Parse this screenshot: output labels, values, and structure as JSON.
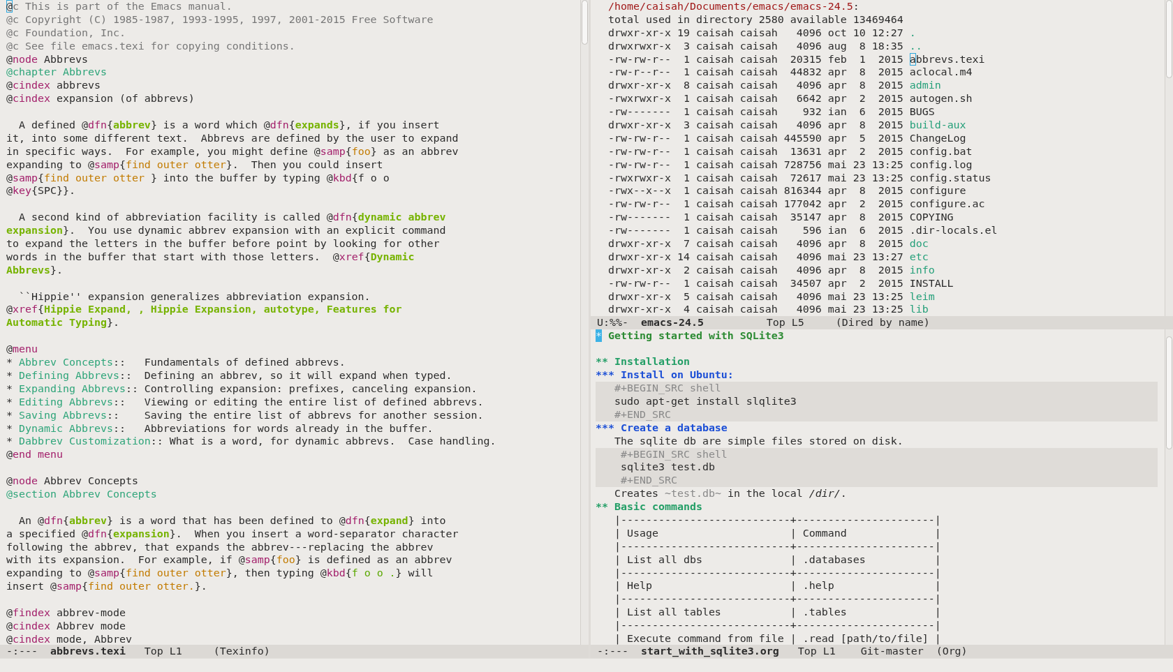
{
  "left_window": {
    "lines": [
      {
        "kind": "text",
        "segments": [
          {
            "kind": "cursor",
            "text": "@"
          },
          {
            "kind": "comment",
            "text": "c This is part of the Emacs manual."
          }
        ]
      },
      {
        "kind": "text",
        "segments": [
          {
            "kind": "comment",
            "text": "@c Copyright (C) 1985-1987, 1993-1995, 1997, 2001-2015 Free Software"
          }
        ]
      },
      {
        "kind": "text",
        "segments": [
          {
            "kind": "comment",
            "text": "@c Foundation, Inc."
          }
        ]
      },
      {
        "kind": "text",
        "segments": [
          {
            "kind": "comment",
            "text": "@c See file emacs.texi for copying conditions."
          }
        ]
      },
      {
        "kind": "text",
        "segments": [
          {
            "kind": "plain",
            "text": "@"
          },
          {
            "kind": "keyword",
            "text": "node"
          },
          {
            "kind": "plain",
            "text": " Abbrevs"
          }
        ]
      },
      {
        "kind": "text",
        "segments": [
          {
            "kind": "heading",
            "text": "@chapter Abbrevs"
          }
        ]
      },
      {
        "kind": "text",
        "segments": [
          {
            "kind": "plain",
            "text": "@"
          },
          {
            "kind": "keyword",
            "text": "cindex"
          },
          {
            "kind": "plain",
            "text": " abbrevs"
          }
        ]
      },
      {
        "kind": "text",
        "segments": [
          {
            "kind": "plain",
            "text": "@"
          },
          {
            "kind": "keyword",
            "text": "cindex"
          },
          {
            "kind": "plain",
            "text": " expansion (of abbrevs)"
          }
        ]
      },
      {
        "kind": "blank"
      },
      {
        "kind": "text",
        "segments": [
          {
            "kind": "plain",
            "text": "  A defined @"
          },
          {
            "kind": "keyword",
            "text": "dfn"
          },
          {
            "kind": "plain",
            "text": "{"
          },
          {
            "kind": "term",
            "text": "abbrev"
          },
          {
            "kind": "plain",
            "text": "} is a word which @"
          },
          {
            "kind": "keyword",
            "text": "dfn"
          },
          {
            "kind": "plain",
            "text": "{"
          },
          {
            "kind": "term",
            "text": "expands"
          },
          {
            "kind": "plain",
            "text": "}, if you insert"
          }
        ]
      },
      {
        "kind": "text",
        "segments": [
          {
            "kind": "plain",
            "text": "it, into some different text.  Abbrevs are defined by the user to expand"
          }
        ]
      },
      {
        "kind": "text",
        "segments": [
          {
            "kind": "plain",
            "text": "in specific ways.  For example, you might define @"
          },
          {
            "kind": "keyword",
            "text": "samp"
          },
          {
            "kind": "plain",
            "text": "{"
          },
          {
            "kind": "sample",
            "text": "foo"
          },
          {
            "kind": "plain",
            "text": "} as an abbrev"
          }
        ]
      },
      {
        "kind": "text",
        "segments": [
          {
            "kind": "plain",
            "text": "expanding to @"
          },
          {
            "kind": "keyword",
            "text": "samp"
          },
          {
            "kind": "plain",
            "text": "{"
          },
          {
            "kind": "sample",
            "text": "find outer otter"
          },
          {
            "kind": "plain",
            "text": "}.  Then you could insert"
          }
        ]
      },
      {
        "kind": "text",
        "segments": [
          {
            "kind": "plain",
            "text": "@"
          },
          {
            "kind": "keyword",
            "text": "samp"
          },
          {
            "kind": "plain",
            "text": "{"
          },
          {
            "kind": "sample",
            "text": "find outer otter "
          },
          {
            "kind": "plain",
            "text": "} into the buffer by typing @"
          },
          {
            "kind": "keyword",
            "text": "kbd"
          },
          {
            "kind": "plain",
            "text": "{f o o"
          }
        ]
      },
      {
        "kind": "text",
        "segments": [
          {
            "kind": "plain",
            "text": "@"
          },
          {
            "kind": "keyword",
            "text": "key"
          },
          {
            "kind": "plain",
            "text": "{SPC}}."
          }
        ]
      },
      {
        "kind": "blank"
      },
      {
        "kind": "text",
        "segments": [
          {
            "kind": "plain",
            "text": "  A second kind of abbreviation facility is called @"
          },
          {
            "kind": "keyword",
            "text": "dfn"
          },
          {
            "kind": "plain",
            "text": "{"
          },
          {
            "kind": "term",
            "text": "dynamic abbrev"
          }
        ]
      },
      {
        "kind": "text",
        "segments": [
          {
            "kind": "term",
            "text": "expansion"
          },
          {
            "kind": "plain",
            "text": "}.  You use dynamic abbrev expansion with an explicit command"
          }
        ]
      },
      {
        "kind": "text",
        "segments": [
          {
            "kind": "plain",
            "text": "to expand the letters in the buffer before point by looking for other"
          }
        ]
      },
      {
        "kind": "text",
        "segments": [
          {
            "kind": "plain",
            "text": "words in the buffer that start with those letters.  @"
          },
          {
            "kind": "keyword",
            "text": "xref"
          },
          {
            "kind": "plain",
            "text": "{"
          },
          {
            "kind": "term",
            "text": "Dynamic"
          }
        ]
      },
      {
        "kind": "text",
        "segments": [
          {
            "kind": "term",
            "text": "Abbrevs"
          },
          {
            "kind": "plain",
            "text": "}."
          }
        ]
      },
      {
        "kind": "blank"
      },
      {
        "kind": "text",
        "segments": [
          {
            "kind": "plain",
            "text": "  ``Hippie'' expansion generalizes abbreviation expansion."
          }
        ]
      },
      {
        "kind": "text",
        "segments": [
          {
            "kind": "plain",
            "text": "@"
          },
          {
            "kind": "keyword",
            "text": "xref"
          },
          {
            "kind": "plain",
            "text": "{"
          },
          {
            "kind": "term",
            "text": "Hippie Expand, , Hippie Expansion, autotype, Features for"
          }
        ]
      },
      {
        "kind": "text",
        "segments": [
          {
            "kind": "term",
            "text": "Automatic Typing"
          },
          {
            "kind": "plain",
            "text": "}."
          }
        ]
      },
      {
        "kind": "blank"
      },
      {
        "kind": "text",
        "segments": [
          {
            "kind": "plain",
            "text": "@"
          },
          {
            "kind": "keyword",
            "text": "menu"
          }
        ]
      },
      {
        "kind": "text",
        "segments": [
          {
            "kind": "plain",
            "text": "* "
          },
          {
            "kind": "heading",
            "text": "Abbrev Concepts"
          },
          {
            "kind": "plain",
            "text": "::   Fundamentals of defined abbrevs."
          }
        ]
      },
      {
        "kind": "text",
        "segments": [
          {
            "kind": "plain",
            "text": "* "
          },
          {
            "kind": "heading",
            "text": "Defining Abbrevs"
          },
          {
            "kind": "plain",
            "text": "::  Defining an abbrev, so it will expand when typed."
          }
        ]
      },
      {
        "kind": "text",
        "segments": [
          {
            "kind": "plain",
            "text": "* "
          },
          {
            "kind": "heading",
            "text": "Expanding Abbrevs"
          },
          {
            "kind": "plain",
            "text": ":: Controlling expansion: prefixes, canceling expansion."
          }
        ]
      },
      {
        "kind": "text",
        "segments": [
          {
            "kind": "plain",
            "text": "* "
          },
          {
            "kind": "heading",
            "text": "Editing Abbrevs"
          },
          {
            "kind": "plain",
            "text": "::   Viewing or editing the entire list of defined abbrevs."
          }
        ]
      },
      {
        "kind": "text",
        "segments": [
          {
            "kind": "plain",
            "text": "* "
          },
          {
            "kind": "heading",
            "text": "Saving Abbrevs"
          },
          {
            "kind": "plain",
            "text": "::    Saving the entire list of abbrevs for another session."
          }
        ]
      },
      {
        "kind": "text",
        "segments": [
          {
            "kind": "plain",
            "text": "* "
          },
          {
            "kind": "heading",
            "text": "Dynamic Abbrevs"
          },
          {
            "kind": "plain",
            "text": "::   Abbreviations for words already in the buffer."
          }
        ]
      },
      {
        "kind": "text",
        "segments": [
          {
            "kind": "plain",
            "text": "* "
          },
          {
            "kind": "heading",
            "text": "Dabbrev Customization"
          },
          {
            "kind": "plain",
            "text": ":: What is a word, for dynamic abbrevs.  Case handling."
          }
        ]
      },
      {
        "kind": "text",
        "segments": [
          {
            "kind": "plain",
            "text": "@"
          },
          {
            "kind": "keyword",
            "text": "end menu"
          }
        ]
      },
      {
        "kind": "blank"
      },
      {
        "kind": "text",
        "segments": [
          {
            "kind": "plain",
            "text": "@"
          },
          {
            "kind": "keyword",
            "text": "node"
          },
          {
            "kind": "plain",
            "text": " Abbrev Concepts"
          }
        ]
      },
      {
        "kind": "text",
        "segments": [
          {
            "kind": "heading",
            "text": "@section Abbrev Concepts"
          }
        ]
      },
      {
        "kind": "blank"
      },
      {
        "kind": "text",
        "segments": [
          {
            "kind": "plain",
            "text": "  An @"
          },
          {
            "kind": "keyword",
            "text": "dfn"
          },
          {
            "kind": "plain",
            "text": "{"
          },
          {
            "kind": "term",
            "text": "abbrev"
          },
          {
            "kind": "plain",
            "text": "} is a word that has been defined to @"
          },
          {
            "kind": "keyword",
            "text": "dfn"
          },
          {
            "kind": "plain",
            "text": "{"
          },
          {
            "kind": "term",
            "text": "expand"
          },
          {
            "kind": "plain",
            "text": "} into"
          }
        ]
      },
      {
        "kind": "text",
        "segments": [
          {
            "kind": "plain",
            "text": "a specified @"
          },
          {
            "kind": "keyword",
            "text": "dfn"
          },
          {
            "kind": "plain",
            "text": "{"
          },
          {
            "kind": "term",
            "text": "expansion"
          },
          {
            "kind": "plain",
            "text": "}.  When you insert a word-separator character"
          }
        ]
      },
      {
        "kind": "text",
        "segments": [
          {
            "kind": "plain",
            "text": "following the abbrev, that expands the abbrev---replacing the abbrev"
          }
        ]
      },
      {
        "kind": "text",
        "segments": [
          {
            "kind": "plain",
            "text": "with its expansion.  For example, if @"
          },
          {
            "kind": "keyword",
            "text": "samp"
          },
          {
            "kind": "plain",
            "text": "{"
          },
          {
            "kind": "sample",
            "text": "foo"
          },
          {
            "kind": "plain",
            "text": "} is defined as an abbrev"
          }
        ]
      },
      {
        "kind": "text",
        "segments": [
          {
            "kind": "plain",
            "text": "expanding to @"
          },
          {
            "kind": "keyword",
            "text": "samp"
          },
          {
            "kind": "plain",
            "text": "{"
          },
          {
            "kind": "sample",
            "text": "find outer otter"
          },
          {
            "kind": "plain",
            "text": "}, then typing @"
          },
          {
            "kind": "keyword",
            "text": "kbd"
          },
          {
            "kind": "plain",
            "text": "{"
          },
          {
            "kind": "key",
            "text": "f o o ."
          },
          {
            "kind": "plain",
            "text": "} will"
          }
        ]
      },
      {
        "kind": "text",
        "segments": [
          {
            "kind": "plain",
            "text": "insert @"
          },
          {
            "kind": "keyword",
            "text": "samp"
          },
          {
            "kind": "plain",
            "text": "{"
          },
          {
            "kind": "sample",
            "text": "find outer otter."
          },
          {
            "kind": "plain",
            "text": "}."
          }
        ]
      },
      {
        "kind": "blank"
      },
      {
        "kind": "text",
        "segments": [
          {
            "kind": "plain",
            "text": "@"
          },
          {
            "kind": "keyword",
            "text": "findex"
          },
          {
            "kind": "plain",
            "text": " abbrev-mode"
          }
        ]
      },
      {
        "kind": "text",
        "segments": [
          {
            "kind": "plain",
            "text": "@"
          },
          {
            "kind": "keyword",
            "text": "cindex"
          },
          {
            "kind": "plain",
            "text": " Abbrev mode"
          }
        ]
      },
      {
        "kind": "text",
        "segments": [
          {
            "kind": "plain",
            "text": "@"
          },
          {
            "kind": "keyword",
            "text": "cindex"
          },
          {
            "kind": "plain",
            "text": " mode, Abbrev"
          }
        ]
      }
    ],
    "mode_line": [
      {
        "kind": "plain",
        "text": "-:---  "
      },
      {
        "kind": "buffer",
        "text": "abbrevs.texi"
      },
      {
        "kind": "plain",
        "text": "   Top L1     (Texinfo)"
      }
    ]
  },
  "dired_window": {
    "lines": [
      {
        "kind": "text",
        "segments": [
          {
            "kind": "path",
            "text": "  /home/caisah/Documents/emacs/emacs-24.5"
          },
          {
            "kind": "plain",
            "text": ":"
          }
        ]
      },
      {
        "kind": "text",
        "segments": [
          {
            "kind": "plain",
            "text": "  total used in directory 2580 available 13469464"
          }
        ]
      },
      {
        "kind": "text",
        "segments": [
          {
            "kind": "plain",
            "text": "  drwxr-xr-x 19 caisah caisah   4096 oct 10 12:27 "
          },
          {
            "kind": "dir",
            "text": "."
          }
        ]
      },
      {
        "kind": "text",
        "segments": [
          {
            "kind": "plain",
            "text": "  drwxrwxr-x  3 caisah caisah   4096 aug  8 18:35 "
          },
          {
            "kind": "dir",
            "text": ".."
          }
        ]
      },
      {
        "kind": "text",
        "segments": [
          {
            "kind": "plain",
            "text": "  -rw-rw-r--  1 caisah caisah  20315 feb  1  2015 "
          },
          {
            "kind": "cursor",
            "text": "a"
          },
          {
            "kind": "plain",
            "text": "bbrevs.texi"
          }
        ]
      },
      {
        "kind": "text",
        "segments": [
          {
            "kind": "plain",
            "text": "  -rw-r--r--  1 caisah caisah  44832 apr  8  2015 aclocal.m4"
          }
        ]
      },
      {
        "kind": "text",
        "segments": [
          {
            "kind": "plain",
            "text": "  drwxr-xr-x  8 caisah caisah   4096 apr  8  2015 "
          },
          {
            "kind": "dir",
            "text": "admin"
          }
        ]
      },
      {
        "kind": "text",
        "segments": [
          {
            "kind": "plain",
            "text": "  -rwxrwxr-x  1 caisah caisah   6642 apr  2  2015 autogen.sh"
          }
        ]
      },
      {
        "kind": "text",
        "segments": [
          {
            "kind": "plain",
            "text": "  -rw-------  1 caisah caisah    932 ian  6  2015 BUGS"
          }
        ]
      },
      {
        "kind": "text",
        "segments": [
          {
            "kind": "plain",
            "text": "  drwxr-xr-x  3 caisah caisah   4096 apr  8  2015 "
          },
          {
            "kind": "dir",
            "text": "build-aux"
          }
        ]
      },
      {
        "kind": "text",
        "segments": [
          {
            "kind": "plain",
            "text": "  -rw-rw-r--  1 caisah caisah 445590 apr  5  2015 ChangeLog"
          }
        ]
      },
      {
        "kind": "text",
        "segments": [
          {
            "kind": "plain",
            "text": "  -rw-rw-r--  1 caisah caisah  13631 apr  2  2015 config.bat"
          }
        ]
      },
      {
        "kind": "text",
        "segments": [
          {
            "kind": "plain",
            "text": "  -rw-rw-r--  1 caisah caisah 728756 mai 23 13:25 config.log"
          }
        ]
      },
      {
        "kind": "text",
        "segments": [
          {
            "kind": "plain",
            "text": "  -rwxrwxr-x  1 caisah caisah  72617 mai 23 13:25 config.status"
          }
        ]
      },
      {
        "kind": "text",
        "segments": [
          {
            "kind": "plain",
            "text": "  -rwx--x--x  1 caisah caisah 816344 apr  8  2015 configure"
          }
        ]
      },
      {
        "kind": "text",
        "segments": [
          {
            "kind": "plain",
            "text": "  -rw-rw-r--  1 caisah caisah 177042 apr  2  2015 configure.ac"
          }
        ]
      },
      {
        "kind": "text",
        "segments": [
          {
            "kind": "plain",
            "text": "  -rw-------  1 caisah caisah  35147 apr  8  2015 COPYING"
          }
        ]
      },
      {
        "kind": "text",
        "segments": [
          {
            "kind": "plain",
            "text": "  -rw-------  1 caisah caisah    596 ian  6  2015 .dir-locals.el"
          }
        ]
      },
      {
        "kind": "text",
        "segments": [
          {
            "kind": "plain",
            "text": "  drwxr-xr-x  7 caisah caisah   4096 apr  8  2015 "
          },
          {
            "kind": "dir",
            "text": "doc"
          }
        ]
      },
      {
        "kind": "text",
        "segments": [
          {
            "kind": "plain",
            "text": "  drwxr-xr-x 14 caisah caisah   4096 mai 23 13:27 "
          },
          {
            "kind": "dir",
            "text": "etc"
          }
        ]
      },
      {
        "kind": "text",
        "segments": [
          {
            "kind": "plain",
            "text": "  drwxr-xr-x  2 caisah caisah   4096 apr  8  2015 "
          },
          {
            "kind": "dir",
            "text": "info"
          }
        ]
      },
      {
        "kind": "text",
        "segments": [
          {
            "kind": "plain",
            "text": "  -rw-rw-r--  1 caisah caisah  34507 apr  2  2015 INSTALL"
          }
        ]
      },
      {
        "kind": "text",
        "segments": [
          {
            "kind": "plain",
            "text": "  drwxr-xr-x  5 caisah caisah   4096 mai 23 13:25 "
          },
          {
            "kind": "dir",
            "text": "leim"
          }
        ]
      },
      {
        "kind": "text",
        "segments": [
          {
            "kind": "plain",
            "text": "  drwxr-xr-x  4 caisah caisah   4096 mai 23 13:25 "
          },
          {
            "kind": "dir",
            "text": "lib"
          }
        ]
      }
    ],
    "mode_line": [
      {
        "kind": "plain",
        "text": "U:%%-  "
      },
      {
        "kind": "buffer",
        "text": "emacs-24.5"
      },
      {
        "kind": "plain",
        "text": "          Top L5     (Dired by name)"
      }
    ]
  },
  "org_window": {
    "lines": [
      {
        "kind": "text",
        "segments": [
          {
            "kind": "cursor-block",
            "text": "*"
          },
          {
            "kind": "title",
            "text": " Getting started with SQLite3"
          }
        ]
      },
      {
        "kind": "blank"
      },
      {
        "kind": "text",
        "segments": [
          {
            "kind": "level-2",
            "text": "** Installation"
          }
        ]
      },
      {
        "kind": "text",
        "segments": [
          {
            "kind": "level-3",
            "text": "*** Install on Ubuntu:"
          }
        ]
      },
      {
        "kind": "block",
        "segments": [
          {
            "kind": "meta",
            "text": "   #+BEGIN_SRC shell"
          }
        ]
      },
      {
        "kind": "block",
        "segments": [
          {
            "kind": "plain",
            "text": "   sudo apt-get install slqlite3"
          }
        ]
      },
      {
        "kind": "block",
        "segments": [
          {
            "kind": "meta",
            "text": "   #+END_SRC"
          }
        ]
      },
      {
        "kind": "text",
        "segments": [
          {
            "kind": "level-3",
            "text": "*** Create a database"
          }
        ]
      },
      {
        "kind": "text",
        "segments": [
          {
            "kind": "plain",
            "text": "   The sqlite db are simple files stored on disk."
          }
        ]
      },
      {
        "kind": "block",
        "segments": [
          {
            "kind": "meta",
            "text": "    #+BEGIN_SRC shell"
          }
        ]
      },
      {
        "kind": "block",
        "segments": [
          {
            "kind": "plain",
            "text": "    sqlite3 test.db"
          }
        ]
      },
      {
        "kind": "block",
        "segments": [
          {
            "kind": "meta",
            "text": "    #+END_SRC"
          }
        ]
      },
      {
        "kind": "text",
        "segments": [
          {
            "kind": "plain",
            "text": "   Creates "
          },
          {
            "kind": "verbatim",
            "text": "~test.db~"
          },
          {
            "kind": "plain",
            "text": " in the local "
          },
          {
            "kind": "italic",
            "text": "/dir/"
          },
          {
            "kind": "plain",
            "text": "."
          }
        ]
      },
      {
        "kind": "text",
        "segments": [
          {
            "kind": "level-2",
            "text": "** Basic commands"
          }
        ]
      },
      {
        "kind": "text",
        "segments": [
          {
            "kind": "plain",
            "text": "   |---------------------------+----------------------|"
          }
        ]
      },
      {
        "kind": "text",
        "segments": [
          {
            "kind": "plain",
            "text": "   | Usage                     | Command              |"
          }
        ]
      },
      {
        "kind": "text",
        "segments": [
          {
            "kind": "plain",
            "text": "   |---------------------------+----------------------|"
          }
        ]
      },
      {
        "kind": "text",
        "segments": [
          {
            "kind": "plain",
            "text": "   | List all dbs              | .databases           |"
          }
        ]
      },
      {
        "kind": "text",
        "segments": [
          {
            "kind": "plain",
            "text": "   |---------------------------+----------------------|"
          }
        ]
      },
      {
        "kind": "text",
        "segments": [
          {
            "kind": "plain",
            "text": "   | Help                      | .help                |"
          }
        ]
      },
      {
        "kind": "text",
        "segments": [
          {
            "kind": "plain",
            "text": "   |---------------------------+----------------------|"
          }
        ]
      },
      {
        "kind": "text",
        "segments": [
          {
            "kind": "plain",
            "text": "   | List all tables           | .tables              |"
          }
        ]
      },
      {
        "kind": "text",
        "segments": [
          {
            "kind": "plain",
            "text": "   |---------------------------+----------------------|"
          }
        ]
      },
      {
        "kind": "text",
        "segments": [
          {
            "kind": "plain",
            "text": "   | Execute command from file | .read [path/to/file] |"
          }
        ]
      }
    ],
    "mode_line": [
      {
        "kind": "plain",
        "text": "-:---  "
      },
      {
        "kind": "buffer",
        "text": "start_with_sqlite3.org"
      },
      {
        "kind": "plain",
        "text": "   Top L1    Git-master  (Org)"
      }
    ]
  }
}
